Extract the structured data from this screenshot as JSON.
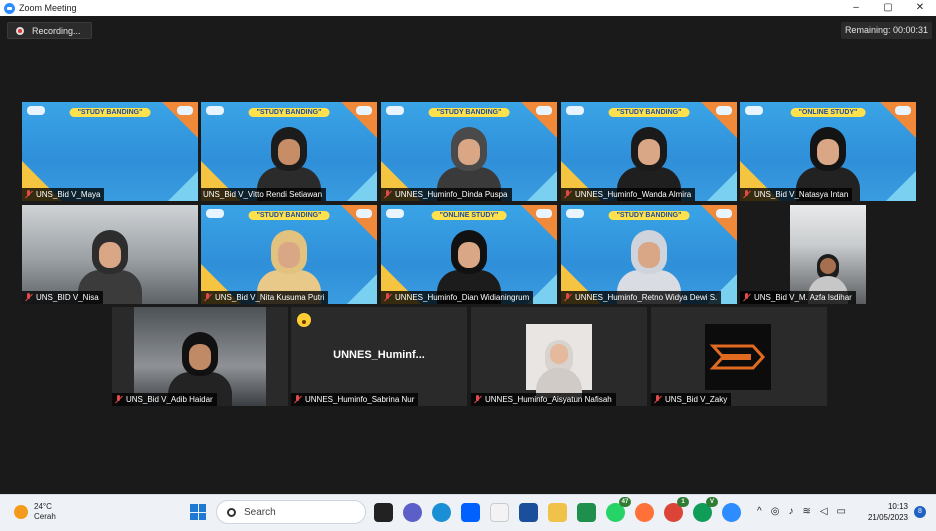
{
  "window": {
    "title": "Zoom Meeting",
    "controls": [
      "–",
      "▢",
      "✕"
    ]
  },
  "meeting": {
    "recording_label": "Recording...",
    "remaining": "Remaining: 00:00:31",
    "active_speaker": "UNS_Bid V_Vitto Rendi Setiawan",
    "participants": [
      {
        "name": "UNS_Bid V_Maya",
        "kind": "slide",
        "banner": "\"STUDY BANDING\""
      },
      {
        "name": "UNS_Bid V_Vitto Rendi Setiawan",
        "kind": "slide-cam",
        "banner": "\"STUDY BANDING\""
      },
      {
        "name": "UNNES_Huminfo_Dinda Puspa",
        "kind": "slide-cam",
        "banner": "\"STUDY BANDING\""
      },
      {
        "name": "UNNES_Huminfo_Wanda Almira",
        "kind": "slide-cam",
        "banner": "\"STUDY BANDING\""
      },
      {
        "name": "UNS_Bid V_Natasya Intan",
        "kind": "slide-cam",
        "banner": "\"ONLINE STUDY\""
      },
      {
        "name": "UNS_BID V_Nisa",
        "kind": "camera"
      },
      {
        "name": "UNS_Bid V_Nita Kusuma Putri",
        "kind": "slide-cam",
        "banner": "\"STUDY BANDING\""
      },
      {
        "name": "UNNES_Huminfo_Dian Widianingrum",
        "kind": "slide-cam",
        "banner": "\"ONLINE STUDY\""
      },
      {
        "name": "UNNES_Huminfo_Retno Widya Dewi S.",
        "kind": "slide-cam",
        "banner": "\"STUDY BANDING\""
      },
      {
        "name": "UNS_Bid V_M. Azfa Isdihar",
        "kind": "camera-small"
      },
      {
        "name": "UNS_Bid V_Adib Haidar",
        "kind": "camera"
      },
      {
        "name": "UNNES_Huminfo_Sabrina Nur",
        "kind": "name-only",
        "display": "UNNES_Huminf..."
      },
      {
        "name": "UNNES_Huminfo_Aisyatun Nafisah",
        "kind": "photo"
      },
      {
        "name": "UNS_Bid V_Zaky",
        "kind": "logo"
      }
    ]
  },
  "taskbar": {
    "weather_temp": "24°C",
    "weather_desc": "Cerah",
    "search_placeholder": "Search",
    "badge_whatsapp": "47",
    "badge_chrome1": "1",
    "badge_chrome2": "V",
    "time": "10:13",
    "date": "21/05/2023",
    "notifications": "8"
  },
  "colors": {
    "accent": "#2d8cff",
    "active_outline": "#e6d600",
    "muted_mic": "#e34a4a",
    "slide_bg": "#3aa4e6"
  }
}
